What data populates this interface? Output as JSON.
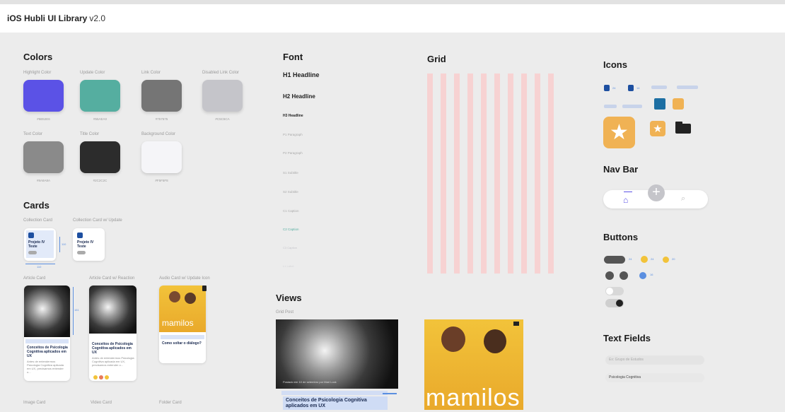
{
  "header": {
    "title": "iOS Hubli UI Library",
    "version": "v2.0"
  },
  "colors": {
    "title": "Colors",
    "swatches": [
      {
        "label": "Highlight Color",
        "hex": "#5B52E6",
        "color": "#5b52e6"
      },
      {
        "label": "Update Color",
        "hex": "#55AEA0",
        "color": "#55aea0"
      },
      {
        "label": "Link Color",
        "hex": "#757575",
        "color": "#757575"
      },
      {
        "label": "Disabled Link Color",
        "hex": "#C5C5CA",
        "color": "#c5c5ca"
      },
      {
        "label": "Text Color",
        "hex": "#8A8A8A",
        "color": "#8a8a8a"
      },
      {
        "label": "Title Color",
        "hex": "#2C2C2C",
        "color": "#2c2c2c"
      },
      {
        "label": "Background Color",
        "hex": "#F5F5F8",
        "color": "#f5f5f8"
      }
    ]
  },
  "cards": {
    "title": "Cards",
    "labels": [
      "Collection Card",
      "Collection Card w/ Update",
      "Article Card",
      "Article Card w/ Reaction",
      "Audio Card w/ Update Icon",
      "Image Card",
      "Video Card",
      "Folder Card"
    ],
    "collection_title": "Projeto IV Teste",
    "article_title": "Conceitos de Psicologia Cognitiva aplicados em UX",
    "article_body": "Antes de entendermos Psicologia Cognitiva aplicada em UX, precisamos entender o...",
    "audio_title": "Como soltar o diálogo?",
    "audio_brand": "mamilos",
    "dim_w": "110",
    "dim_h": "110",
    "dim_h2": "161",
    "dim_16": "16"
  },
  "font": {
    "title": "Font",
    "items": [
      "H1 Headline",
      "H2 Headline",
      "H3 Headline",
      "P1 Paragraph",
      "P2 Paragraph",
      "S1 Subtitle",
      "S2 Subtitle",
      "C1 Caption",
      "C2 Caption",
      "C3 Caption",
      "L1 Label"
    ]
  },
  "grid": {
    "title": "Grid"
  },
  "views": {
    "title": "Views",
    "grid_post": "Grid Post",
    "post_caption": "Postado em 10 de setembro por Mari Lock",
    "post_title": "Conceitos de Psicologia Cognitiva aplicados em UX",
    "brand": "mamilos"
  },
  "icons": {
    "title": "Icons",
    "sizes": [
      "24",
      "14",
      "16",
      "14"
    ],
    "accent": "#f0b254",
    "blue": "#1d6fa3"
  },
  "nav_bar": {
    "title": "Nav Bar"
  },
  "buttons": {
    "title": "Buttons",
    "sizes": [
      "24",
      "24",
      "20",
      "16",
      "24"
    ]
  },
  "text_fields": {
    "title": "Text Fields",
    "placeholder": "Ex: Grupo de Estudos",
    "value": "Psicologia Cognitiva"
  }
}
